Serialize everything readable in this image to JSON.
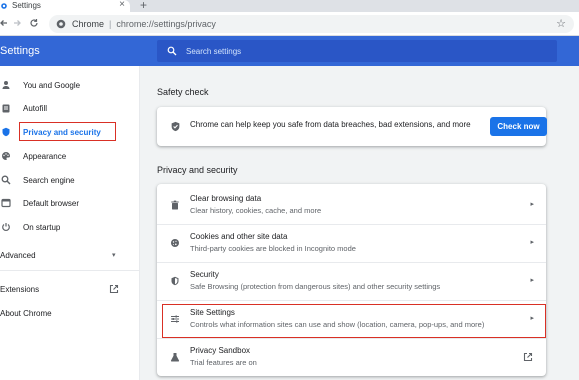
{
  "browser": {
    "tab_title": "Settings",
    "tab_close": "×",
    "new_tab": "+",
    "site_name": "Chrome",
    "separator": "|",
    "url": "chrome://settings/privacy",
    "bookmark_star": "☆"
  },
  "header": {
    "title": "Settings",
    "search_placeholder": "Search settings"
  },
  "sidebar": {
    "items": [
      {
        "label": "You and Google",
        "icon": "person-icon"
      },
      {
        "label": "Autofill",
        "icon": "clipboard-icon"
      },
      {
        "label": "Privacy and security",
        "icon": "shield-icon"
      },
      {
        "label": "Appearance",
        "icon": "palette-icon"
      },
      {
        "label": "Search engine",
        "icon": "search-icon"
      },
      {
        "label": "Default browser",
        "icon": "browser-icon"
      },
      {
        "label": "On startup",
        "icon": "power-icon"
      }
    ],
    "advanced": "Advanced",
    "advanced_caret": "▾",
    "extensions": "Extensions",
    "about": "About Chrome",
    "active_item": "Privacy and security"
  },
  "main": {
    "safety_title": "Safety check",
    "safety_text": "Chrome can help keep you safe from data breaches, bad extensions, and more",
    "check_button": "Check now",
    "privacy_title": "Privacy and security",
    "arrow": "▸",
    "rows": [
      {
        "title": "Clear browsing data",
        "subtitle": "Clear history, cookies, cache, and more",
        "icon": "trash-icon"
      },
      {
        "title": "Cookies and other site data",
        "subtitle": "Third-party cookies are blocked in Incognito mode",
        "icon": "cookie-icon"
      },
      {
        "title": "Security",
        "subtitle": "Safe Browsing (protection from dangerous sites) and other security settings",
        "icon": "shield-icon"
      },
      {
        "title": "Site Settings",
        "subtitle": "Controls what information sites can use and show (location, camera, pop-ups, and more)",
        "icon": "sliders-icon"
      },
      {
        "title": "Privacy Sandbox",
        "subtitle": "Trial features are on",
        "icon": "flask-icon"
      }
    ]
  },
  "colors": {
    "header": "#3367d6",
    "accent": "#1a73e8",
    "highlight_border": "#d93025"
  }
}
